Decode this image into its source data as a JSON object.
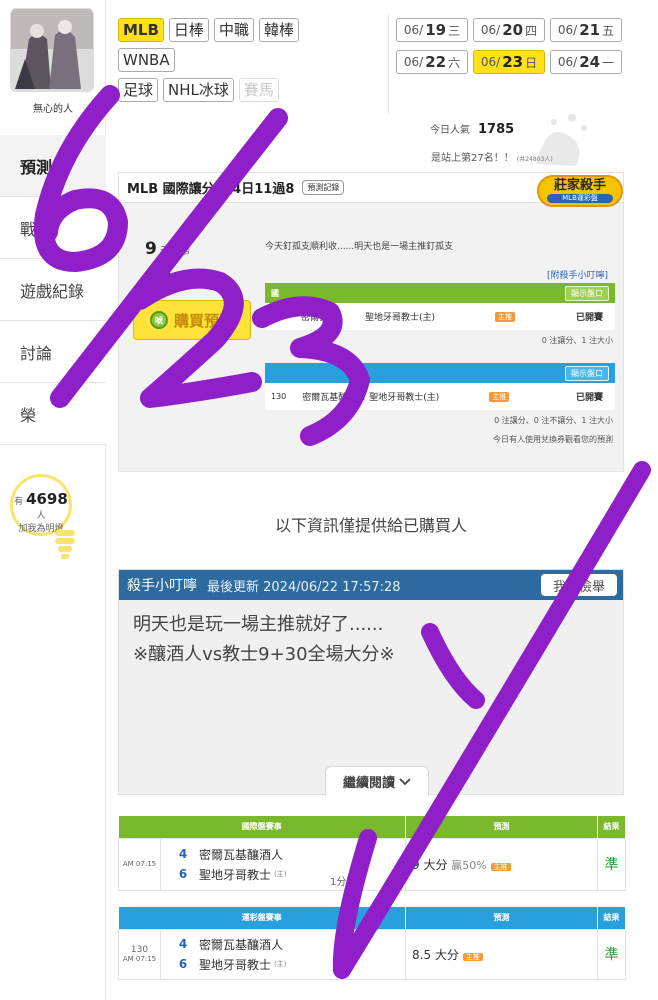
{
  "sidebar": {
    "username": "無心的人",
    "nav": [
      "預測",
      "戰",
      "遊戲紀錄",
      "討論",
      "榮"
    ],
    "fans_prefix": "有",
    "fans_count": "4698",
    "fans_suffix": "人",
    "fans_cta": "加我為明燈"
  },
  "leagues": {
    "row1": [
      "MLB",
      "日棒",
      "中職",
      "韓棒"
    ],
    "row2": [
      "WNBA"
    ],
    "row3": [
      "足球",
      "NHL冰球",
      "賽馬"
    ]
  },
  "dates": [
    {
      "md_prefix": "06/",
      "day": "19",
      "wd": "三"
    },
    {
      "md_prefix": "06/",
      "day": "20",
      "wd": "四"
    },
    {
      "md_prefix": "06/",
      "day": "21",
      "wd": "五"
    },
    {
      "md_prefix": "06/",
      "day": "22",
      "wd": "六"
    },
    {
      "md_prefix": "06/",
      "day": "23",
      "wd": "日"
    },
    {
      "md_prefix": "06/",
      "day": "24",
      "wd": "一"
    }
  ],
  "stats": {
    "popularity_label": "今日人氣",
    "popularity_value": "1785",
    "rank_text": "是站上第27名！！",
    "rank_small": "(共24803人)"
  },
  "card": {
    "title": "MLB 國際讓分 近4日11過8",
    "record_btn": "預測記錄",
    "badge_title": "莊家殺手",
    "badge_sub": "MLB運彩盤",
    "price_value": "9",
    "price_unit": "元唬幣",
    "buyers_value": "23",
    "buyers_unit": "人購買",
    "buy_label": "購買預測",
    "buy_coin": "唬",
    "note": "今天釘孤支順利收......明天也是一場主推釘孤支",
    "tip_link": "[附殺手小叮嚀]",
    "t1_header": "國",
    "show_label": "顯示盤口",
    "t1_row": "密爾瓦基釀酒人 vs 聖地牙哥教士(主)",
    "t1_away": "密爾瓦基",
    "t1_home": "聖地牙哥教士(主)",
    "main_tag": "主推",
    "opened": "已開賽",
    "t1_sub": "0 注讓分、1 注大小",
    "t2_num": "130",
    "t2_row": "密爾瓦基釀酒人 vs 聖地牙哥教士(主)",
    "t2_away": "密爾瓦基釀酒人",
    "t2_home": "聖地牙哥教士(主)",
    "t2_sub": "0 注讓分、0 注不讓分、1 注大小",
    "t2_sub2": "今日有人使用兌換券觀看您的預測"
  },
  "buyers_info": "以下資訊僅提供給已購買人",
  "tip": {
    "title": "殺手小叮嚀",
    "updated": "最後更新 2024/06/22 17:57:28",
    "report": "我要檢舉",
    "line1": "明天也是玩一場主推就好了......",
    "line2": "※釀酒人vs教士9+30全場大分※",
    "read_more": "繼續閱讀"
  },
  "results": {
    "intl": {
      "headers": [
        "國際盤賽事",
        "預測",
        "結果"
      ],
      "time": "AM 07:15",
      "away_score": "4",
      "away": "密爾瓦基釀酒人",
      "home_score": "6",
      "home": "聖地牙哥教士",
      "home_mark": "(主)",
      "win_by": "1分贏",
      "pick": "9 大分",
      "pick_extra": "贏50%",
      "tag": "主推",
      "result": "準"
    },
    "sports": {
      "headers": [
        "運彩盤賽事",
        "預測",
        "結果"
      ],
      "num": "130",
      "time": "AM 07:15",
      "away_score": "4",
      "away": "密爾瓦基釀酒人",
      "home_score": "6",
      "home": "聖地牙哥教士",
      "home_mark": "(主)",
      "pick": "8.5 大分",
      "tag": "主推",
      "result": "準"
    }
  },
  "colors": {
    "active_yellow": "#ffe11a",
    "green_header": "#7ab82e",
    "blue_header": "#29a0dd",
    "tip_header": "#2c6aa0",
    "ink_purple": "#8f1fc8",
    "result_green": "#2e9a34"
  },
  "overlay_handwriting": "6/23 ✓"
}
